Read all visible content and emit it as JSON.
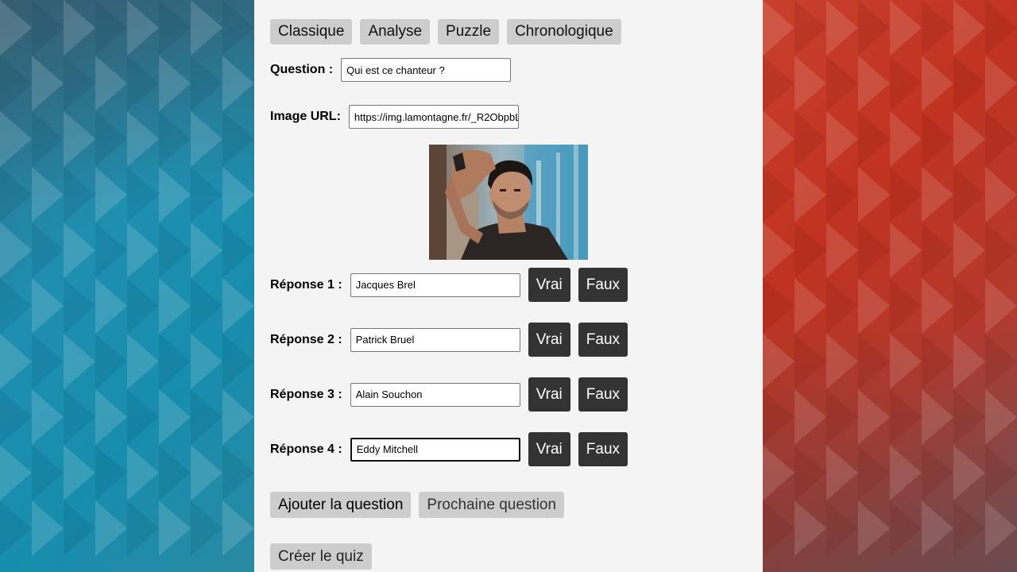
{
  "tabs": [
    "Classique",
    "Analyse",
    "Puzzle",
    "Chronologique"
  ],
  "question": {
    "label": "Question :",
    "value": "Qui est ce chanteur ?"
  },
  "image_url": {
    "label": "Image URL:",
    "value": "https://img.lamontagne.fr/_R2ObpbL"
  },
  "answers": [
    {
      "label": "Réponse 1 :",
      "value": "Jacques Brel"
    },
    {
      "label": "Réponse 2 :",
      "value": "Patrick Bruel"
    },
    {
      "label": "Réponse 3 :",
      "value": "Alain Souchon"
    },
    {
      "label": "Réponse 4 :",
      "value": "Eddy Mitchell"
    }
  ],
  "answer_buttons": {
    "true_label": "Vrai",
    "false_label": "Faux"
  },
  "actions": {
    "add_question": "Ajouter la question",
    "next_question": "Prochaine question",
    "create_quiz": "Créer le quiz"
  },
  "colors": {
    "panel_bg": "#f4f4f4",
    "tab_bg": "#cdcdcd",
    "dark_button_bg": "#333333",
    "left_bg": "#1f8fb0",
    "right_bg": "#c03320"
  }
}
